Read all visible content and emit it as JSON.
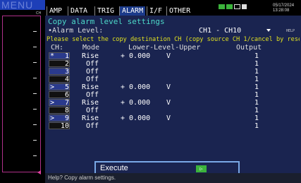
{
  "left": {
    "menu_label": "MENU",
    "ch_label": "CH"
  },
  "tabs": [
    {
      "label": "AMP"
    },
    {
      "label": "DATA"
    },
    {
      "label": "TRIG"
    },
    {
      "label": "ALARM"
    },
    {
      "label": "I/F"
    },
    {
      "label": "OTHER"
    }
  ],
  "status": {
    "date": "05/17/2024",
    "time": "13:28:08"
  },
  "page": {
    "title": "Copy alarm level settings",
    "alarm_level_label": "•Alarm Level:",
    "alarm_level_value": "CH1 - CH10",
    "help_label": "HELP",
    "instruction": "Please select the copy destination CH (copy source CH  1/cancel by reselecting)"
  },
  "table": {
    "headers": [
      "CH:",
      "Mode",
      "Lower-Level-Upper",
      "Output"
    ],
    "rows": [
      {
        "mark": "*",
        "ch": "1",
        "mode": "Rise",
        "lower": "+ 0.000",
        "unit": "V",
        "output": "1"
      },
      {
        "mark": "",
        "ch": "2",
        "mode": "Off",
        "lower": "",
        "unit": "",
        "output": "1"
      },
      {
        "mark": "",
        "ch": "3",
        "mode": "Off",
        "lower": "",
        "unit": "",
        "output": "1"
      },
      {
        "mark": "",
        "ch": "4",
        "mode": "Off",
        "lower": "",
        "unit": "",
        "output": "1"
      },
      {
        "mark": ">",
        "ch": "5",
        "mode": "Rise",
        "lower": "+ 0.000",
        "unit": "V",
        "output": "1"
      },
      {
        "mark": "",
        "ch": "6",
        "mode": "Off",
        "lower": "",
        "unit": "",
        "output": "1"
      },
      {
        "mark": ">",
        "ch": "7",
        "mode": "Rise",
        "lower": "+ 0.000",
        "unit": "V",
        "output": "1"
      },
      {
        "mark": "",
        "ch": "8",
        "mode": "Off",
        "lower": "",
        "unit": "",
        "output": "1"
      },
      {
        "mark": ">",
        "ch": "9",
        "mode": "Rise",
        "lower": "+ 0.000",
        "unit": "V",
        "output": "1"
      },
      {
        "mark": "",
        "ch": "10",
        "mode": "Off",
        "lower": "",
        "unit": "",
        "output": "1"
      }
    ]
  },
  "execute": {
    "label": "Execute",
    "button_glyph": "▷"
  },
  "helpbar": {
    "text": "Help?  Copy alarm settings."
  },
  "colors": {
    "accent": "#1d3fb8",
    "content_bg": "#1a2450",
    "title": "#4dd8c8",
    "instruction": "#e0e020",
    "exec_button": "#3cb33c"
  }
}
